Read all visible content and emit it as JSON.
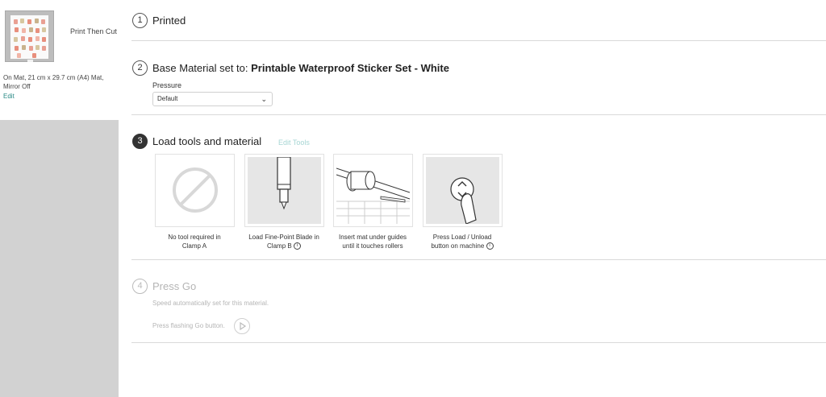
{
  "sidebar": {
    "mat_label": "Print Then Cut",
    "mat_info": "On Mat, 21 cm x 29.7 cm (A4) Mat, Mirror Off",
    "edit_label": "Edit"
  },
  "steps": [
    {
      "number": "1",
      "title": "Printed"
    },
    {
      "number": "2",
      "title_prefix": "Base Material set to:",
      "title_value": "Printable Waterproof Sticker Set - White",
      "pressure_label": "Pressure",
      "pressure_value": "Default"
    },
    {
      "number": "3",
      "title": "Load tools and material",
      "edit_tools": "Edit Tools",
      "tools": [
        {
          "line1": "No tool required in",
          "line2": "Clamp A",
          "icon": "no-tool-icon"
        },
        {
          "line1": "Load Fine-Point Blade in",
          "line2": "Clamp B",
          "icon": "fine-point-blade-icon",
          "info": "i"
        },
        {
          "line1": "Insert mat under guides",
          "line2": "until it touches rollers",
          "icon": "insert-mat-icon"
        },
        {
          "line1": "Press Load / Unload",
          "line2": "button on machine",
          "icon": "load-unload-button-icon",
          "info": "i"
        }
      ]
    },
    {
      "number": "4",
      "title": "Press Go",
      "speed_text": "Speed automatically set for this material.",
      "go_text": "Press flashing Go button."
    }
  ],
  "colors": {
    "accent": "#2a8a86",
    "edit_tools": "#a7d6d4",
    "sidebar_bg": "#d2d2d2"
  }
}
